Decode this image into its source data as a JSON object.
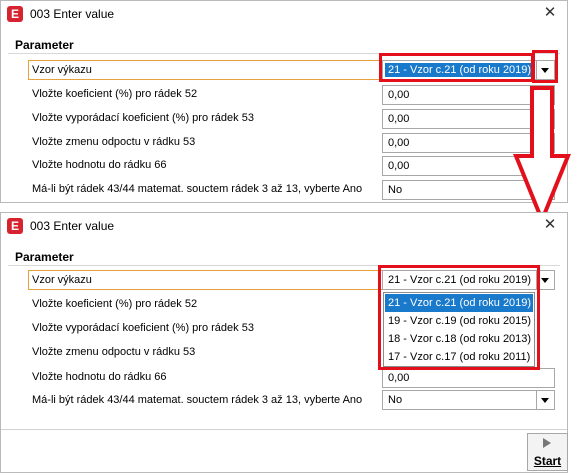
{
  "title": "003 Enter value",
  "app_icon": "E",
  "close_glyph": "✕",
  "group_title": "Parameter",
  "rows": {
    "vzor": "Vzor výkazu",
    "r52": "Vložte koeficient (%) pro rádek 52",
    "r53": "Vložte vyporádací koeficient (%) pro rádek 53",
    "zmena53": "Vložte zmenu odpoctu v rádku 53",
    "r66": "Vložte hodnotu do rádku 66",
    "matemat": "Má-li být rádek 43/44 matemat. souctem rádek 3 až 13, vyberte Ano"
  },
  "values": {
    "vzor_selected": "21 - Vzor c.21 (od roku 2019)",
    "r52": "0,00",
    "r53": "0,00",
    "zmena53": "0,00",
    "r66": "0,00",
    "matemat": "No"
  },
  "vzor_options": [
    "21 - Vzor c.21 (od roku 2019)",
    "19 - Vzor c.19 (od roku 2015)",
    "18 - Vzor c.18 (od roku 2013)",
    "17 - Vzor c.17 (od roku 2011)"
  ],
  "start_label": "Start",
  "colors": {
    "highlight": "#e3101b",
    "selection": "#1979ca",
    "focus_border": "#e4a13c",
    "app_icon": "#d6232f"
  }
}
